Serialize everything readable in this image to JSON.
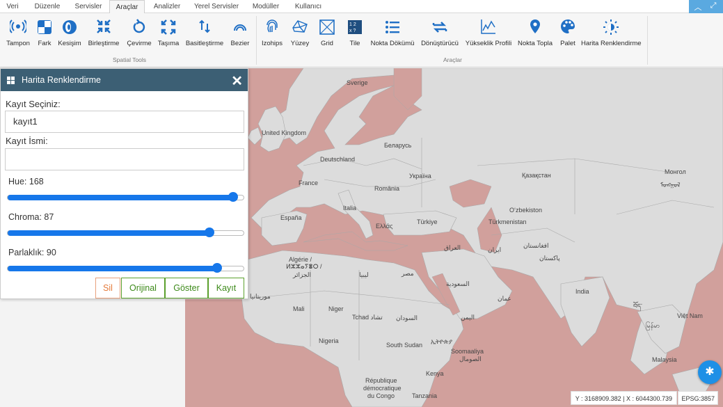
{
  "menu": {
    "tabs": [
      "Veri",
      "Düzenle",
      "Servisler",
      "Araçlar",
      "Analizler",
      "Yerel Servisler",
      "Modüller",
      "Kullanıcı"
    ],
    "active": "Araçlar"
  },
  "ribbon": {
    "spatial_tools": [
      "Tampon",
      "Fark",
      "Kesişim",
      "Birleştirme",
      "Çevirme",
      "Taşıma",
      "Basitleştirme",
      "Bezier"
    ],
    "spatial_group_label": "Spatial Tools",
    "tools": [
      "Izohips",
      "Yüzey",
      "Grid",
      "Tile",
      "Nokta Dökümü",
      "Dönüştürücü",
      "Yükseklik Profili",
      "Nokta Topla",
      "Palet",
      "Harita Renklendirme"
    ],
    "tools_group_label": "Araçlar",
    "accent": "#1f6fc5"
  },
  "panel": {
    "title": "Harita Renklendirme",
    "select_label": "Kayıt Seçiniz:",
    "select_value": "kayıt1",
    "name_label": "Kayıt İsmi:",
    "name_value": "",
    "hue_label": "Hue: 168",
    "hue_fraction": 0.957,
    "chroma_label": "Chroma: 87",
    "chroma_fraction": 0.855,
    "brightness_label": "Parlaklık: 90",
    "brightness_fraction": 0.888,
    "buttons": {
      "delete": "Sil",
      "original": "Orijinal",
      "show": "Göster",
      "save": "Kayıt"
    },
    "header_color": "#3c5f74"
  },
  "map": {
    "labels": {
      "sverige": "Sverige",
      "uk": "United Kingdom",
      "belarus": "Беларусь",
      "deutschland": "Deutschland",
      "ukraina": "Україна",
      "kazakhstan": "Қазақстан",
      "mongol": "Монгол",
      "mongol_script": "ᠮᠣᠩᠭᠣᠯ",
      "france": "France",
      "romania": "România",
      "uzbekiston": "O‘zbekiston",
      "italia": "Italia",
      "espana": "España",
      "ellas": "Ελλάς",
      "turkiye": "Türkiye",
      "turkmenistan": "Türkmenistan",
      "iraq": "العراق",
      "iran": "ایران",
      "afghanistan": "افغانستان",
      "pakistan": "پاکستان",
      "algerie": "Algérie /",
      "algerie_tifinagh": "ⵍⵣⵣⴰⵢⴻⵔ /",
      "algerie_ar": "الجزائر",
      "libya": "ليبيا",
      "misr": "مصر",
      "saudi": "السعودية",
      "oman": "عمان",
      "india": "India",
      "mauritania": "موريتانيا",
      "mali": "Mali",
      "niger": "Niger",
      "tchad": "Tchad تشاد",
      "sudan": "السودان",
      "yemen": "اليمن",
      "tibet": "བོད་",
      "myanmar": "မြန်မာ",
      "vietnam": "Việt Nam",
      "nigeria": "Nigeria",
      "south_sudan": "South Sudan",
      "ethiopia": "ኢትዮጵያ",
      "somaliland": "Soomaaliya",
      "somali_ar": "الصومال",
      "rdc1": "République",
      "rdc2": "démocratique",
      "rdc3": "du Congo",
      "kenya": "Kenya",
      "tanzania": "Tanzania",
      "malaysia": "Malaysia"
    },
    "coords": "Y : 3168909.382 | X : 6044300.739",
    "epsg": "EPSG:3857",
    "sea_color": "#d1a09c",
    "land_color": "#dcdcdc"
  }
}
